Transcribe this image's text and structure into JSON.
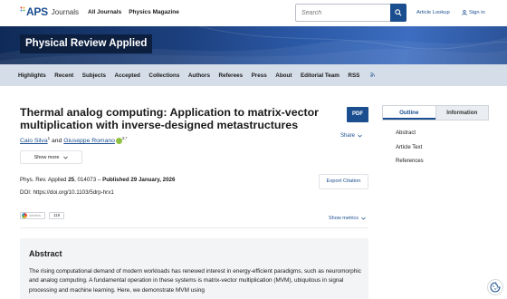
{
  "header": {
    "logo_text": "APS",
    "logo_suffix": "Journals",
    "nav": [
      "All Journals",
      "Physics Magazine"
    ],
    "search_placeholder": "Search",
    "article_lookup": "Article Lookup",
    "sign_in": "Sign in"
  },
  "banner": {
    "journal_title": "Physical Review Applied"
  },
  "section_nav": [
    "Highlights",
    "Recent",
    "Subjects",
    "Accepted",
    "Collections",
    "Authors",
    "Referees",
    "Press",
    "About",
    "Editorial Team",
    "RSS"
  ],
  "article": {
    "title": "Thermal analog computing: Application to matrix-vector multiplication with inverse-designed metastructures",
    "pdf_label": "PDF",
    "share_label": "Share",
    "author1": "Caio Silva",
    "author1_sup": "1",
    "and": "and",
    "author2": "Giuseppe Romano",
    "author2_sup": "2,*",
    "show_more": "Show more",
    "journal_ref_prefix": "Phys. Rev. Applied ",
    "volume": "25",
    "article_number": ", 014073 – ",
    "published": "Published 29 January, 2026",
    "doi": "DOI: https://doi.org/10.1103/5drp-hrx1",
    "export_citation": "Export Citation",
    "altmetric_label": "altmetric",
    "citation_count": "119",
    "show_metrics": "Show metrics"
  },
  "abstract": {
    "heading": "Abstract",
    "text": "The rising computational demand of modern workloads has renewed interest in energy-efficient paradigms, such as neuromorphic and analog computing. A fundamental operation in these systems is matrix-vector multiplication (MVM), ubiquitous in signal processing and machine learning. Here, we demonstrate MVM using"
  },
  "sidebar": {
    "tabs": [
      "Outline",
      "Information"
    ],
    "outline": [
      "Abstract",
      "Article Text",
      "References"
    ]
  },
  "colors": {
    "brand_blue": "#1b4e8f",
    "nav_bg": "#d5dde8",
    "banner_dark": "#0c1f3f"
  }
}
